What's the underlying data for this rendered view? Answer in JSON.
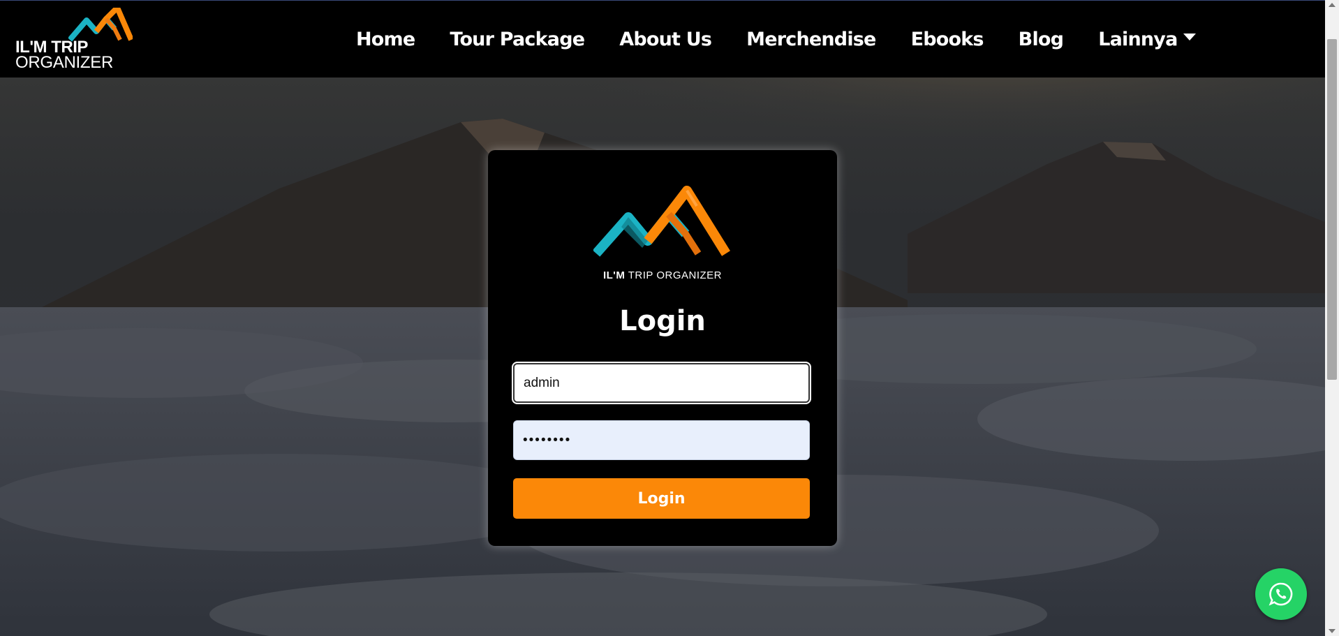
{
  "brand": {
    "line1": "IL'M TRIP",
    "line2": "ORGANIZER"
  },
  "nav": {
    "items": [
      "Home",
      "Tour Package",
      "About Us",
      "Merchendise",
      "Ebooks",
      "Blog"
    ],
    "dropdown_label": "Lainnya"
  },
  "login": {
    "logo_bold": "IL'M",
    "logo_rest": " TRIP ORGANIZER",
    "title": "Login",
    "username_value": "admin",
    "password_value": "••••••••",
    "button_label": "Login"
  },
  "icons": {
    "whatsapp": "whatsapp-icon",
    "dropdown": "caret-down-icon"
  },
  "colors": {
    "accent_orange": "#fb8808",
    "teal": "#1bb3c4",
    "whatsapp_green": "#25d366",
    "navbar": "#000000"
  }
}
